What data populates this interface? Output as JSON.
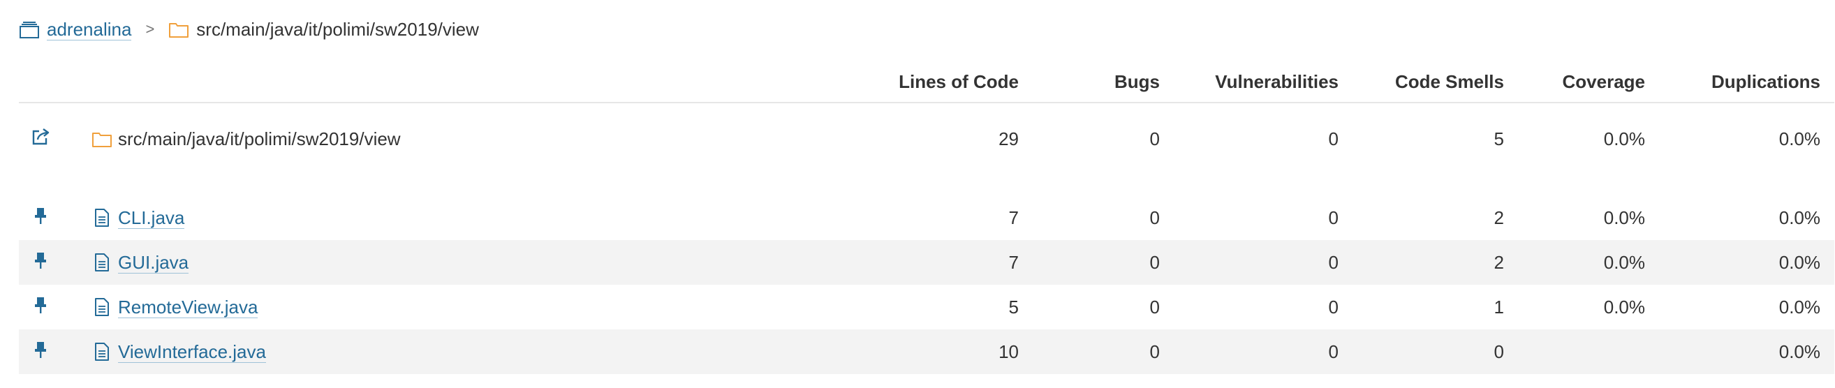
{
  "breadcrumb": {
    "project": "adrenalina",
    "separator": ">",
    "path": "src/main/java/it/polimi/sw2019/view"
  },
  "columns": [
    "Lines of Code",
    "Bugs",
    "Vulnerabilities",
    "Code Smells",
    "Coverage",
    "Duplications"
  ],
  "base": {
    "name": "src/main/java/it/polimi/sw2019/view",
    "icon": "external-link-icon",
    "loc": "29",
    "bugs": "0",
    "vulnerabilities": "0",
    "code_smells": "5",
    "coverage": "0.0%",
    "duplications": "0.0%"
  },
  "files": [
    {
      "name": "CLI.java",
      "icon": "pin-icon",
      "loc": "7",
      "bugs": "0",
      "vulnerabilities": "0",
      "code_smells": "2",
      "coverage": "0.0%",
      "duplications": "0.0%"
    },
    {
      "name": "GUI.java",
      "icon": "pin-icon",
      "loc": "7",
      "bugs": "0",
      "vulnerabilities": "0",
      "code_smells": "2",
      "coverage": "0.0%",
      "duplications": "0.0%"
    },
    {
      "name": "RemoteView.java",
      "icon": "pin-icon",
      "loc": "5",
      "bugs": "0",
      "vulnerabilities": "0",
      "code_smells": "1",
      "coverage": "0.0%",
      "duplications": "0.0%"
    },
    {
      "name": "ViewInterface.java",
      "icon": "pin-icon",
      "loc": "10",
      "bugs": "0",
      "vulnerabilities": "0",
      "code_smells": "0",
      "coverage": "",
      "duplications": "0.0%"
    }
  ],
  "colors": {
    "link": "#236a97",
    "folder_icon": "#f0a03c",
    "file_icon": "#236a97",
    "pin_icon": "#236a97",
    "stripe": "#f3f3f3",
    "header_border": "#e6e6e6"
  }
}
